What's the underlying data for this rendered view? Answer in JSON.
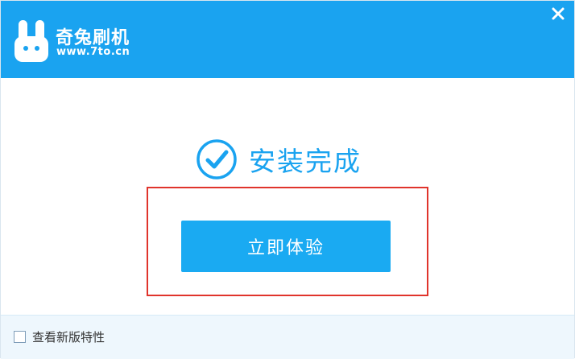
{
  "header": {
    "app_name": "奇兔刷机",
    "url": "www.7to.cn",
    "logo_icon": "rabbit-logo-icon",
    "close_icon": "close-icon"
  },
  "status": {
    "icon": "check-circle-icon",
    "text": "安装完成"
  },
  "primary_button": {
    "label": "立即体验"
  },
  "footer": {
    "checkbox_label": "查看新版特性",
    "checkbox_checked": false
  },
  "colors": {
    "brand": "#1aa3f0",
    "button": "#1aaaf2",
    "highlight": "#e0342c",
    "footer_bg": "#eef7fd"
  }
}
